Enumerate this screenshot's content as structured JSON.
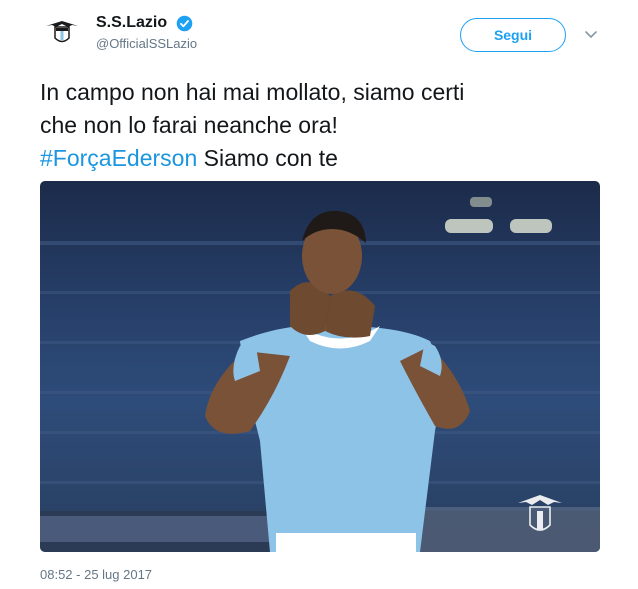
{
  "account": {
    "display_name": "S.S.Lazio",
    "handle": "@OfficialSSLazio",
    "verified": true,
    "verified_icon": "verified-badge-icon",
    "avatar_icon": "lazio-eagle-logo"
  },
  "actions": {
    "follow_label": "Segui",
    "more_icon": "chevron-down-icon"
  },
  "tweet": {
    "text_line1": "In campo non hai mai mollato, siamo certi",
    "text_line2": "che non lo farai neanche ora!",
    "hashtag": "#ForçaEderson",
    "after_hashtag": " Siamo con te"
  },
  "media": {
    "description_icon": "photo",
    "watermark": "LAZIO"
  },
  "timestamp": "08:52 - 25 lug 2017",
  "colors": {
    "accent": "#1da1f2",
    "hashtag": "#1b95e0",
    "muted": "#657786",
    "jersey": "#8ec3e8"
  }
}
